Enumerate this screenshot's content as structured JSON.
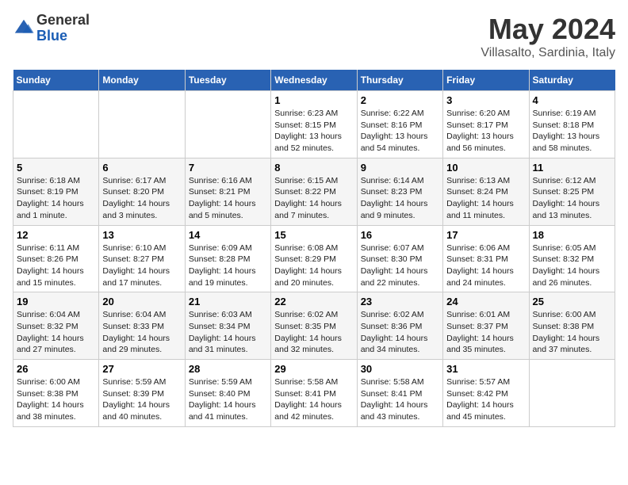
{
  "header": {
    "logo_line1": "General",
    "logo_line2": "Blue",
    "title": "May 2024",
    "location": "Villasalto, Sardinia, Italy"
  },
  "days_of_week": [
    "Sunday",
    "Monday",
    "Tuesday",
    "Wednesday",
    "Thursday",
    "Friday",
    "Saturday"
  ],
  "weeks": [
    [
      {
        "day": "",
        "sunrise": "",
        "sunset": "",
        "daylight": ""
      },
      {
        "day": "",
        "sunrise": "",
        "sunset": "",
        "daylight": ""
      },
      {
        "day": "",
        "sunrise": "",
        "sunset": "",
        "daylight": ""
      },
      {
        "day": "1",
        "sunrise": "Sunrise: 6:23 AM",
        "sunset": "Sunset: 8:15 PM",
        "daylight": "Daylight: 13 hours and 52 minutes."
      },
      {
        "day": "2",
        "sunrise": "Sunrise: 6:22 AM",
        "sunset": "Sunset: 8:16 PM",
        "daylight": "Daylight: 13 hours and 54 minutes."
      },
      {
        "day": "3",
        "sunrise": "Sunrise: 6:20 AM",
        "sunset": "Sunset: 8:17 PM",
        "daylight": "Daylight: 13 hours and 56 minutes."
      },
      {
        "day": "4",
        "sunrise": "Sunrise: 6:19 AM",
        "sunset": "Sunset: 8:18 PM",
        "daylight": "Daylight: 13 hours and 58 minutes."
      }
    ],
    [
      {
        "day": "5",
        "sunrise": "Sunrise: 6:18 AM",
        "sunset": "Sunset: 8:19 PM",
        "daylight": "Daylight: 14 hours and 1 minute."
      },
      {
        "day": "6",
        "sunrise": "Sunrise: 6:17 AM",
        "sunset": "Sunset: 8:20 PM",
        "daylight": "Daylight: 14 hours and 3 minutes."
      },
      {
        "day": "7",
        "sunrise": "Sunrise: 6:16 AM",
        "sunset": "Sunset: 8:21 PM",
        "daylight": "Daylight: 14 hours and 5 minutes."
      },
      {
        "day": "8",
        "sunrise": "Sunrise: 6:15 AM",
        "sunset": "Sunset: 8:22 PM",
        "daylight": "Daylight: 14 hours and 7 minutes."
      },
      {
        "day": "9",
        "sunrise": "Sunrise: 6:14 AM",
        "sunset": "Sunset: 8:23 PM",
        "daylight": "Daylight: 14 hours and 9 minutes."
      },
      {
        "day": "10",
        "sunrise": "Sunrise: 6:13 AM",
        "sunset": "Sunset: 8:24 PM",
        "daylight": "Daylight: 14 hours and 11 minutes."
      },
      {
        "day": "11",
        "sunrise": "Sunrise: 6:12 AM",
        "sunset": "Sunset: 8:25 PM",
        "daylight": "Daylight: 14 hours and 13 minutes."
      }
    ],
    [
      {
        "day": "12",
        "sunrise": "Sunrise: 6:11 AM",
        "sunset": "Sunset: 8:26 PM",
        "daylight": "Daylight: 14 hours and 15 minutes."
      },
      {
        "day": "13",
        "sunrise": "Sunrise: 6:10 AM",
        "sunset": "Sunset: 8:27 PM",
        "daylight": "Daylight: 14 hours and 17 minutes."
      },
      {
        "day": "14",
        "sunrise": "Sunrise: 6:09 AM",
        "sunset": "Sunset: 8:28 PM",
        "daylight": "Daylight: 14 hours and 19 minutes."
      },
      {
        "day": "15",
        "sunrise": "Sunrise: 6:08 AM",
        "sunset": "Sunset: 8:29 PM",
        "daylight": "Daylight: 14 hours and 20 minutes."
      },
      {
        "day": "16",
        "sunrise": "Sunrise: 6:07 AM",
        "sunset": "Sunset: 8:30 PM",
        "daylight": "Daylight: 14 hours and 22 minutes."
      },
      {
        "day": "17",
        "sunrise": "Sunrise: 6:06 AM",
        "sunset": "Sunset: 8:31 PM",
        "daylight": "Daylight: 14 hours and 24 minutes."
      },
      {
        "day": "18",
        "sunrise": "Sunrise: 6:05 AM",
        "sunset": "Sunset: 8:32 PM",
        "daylight": "Daylight: 14 hours and 26 minutes."
      }
    ],
    [
      {
        "day": "19",
        "sunrise": "Sunrise: 6:04 AM",
        "sunset": "Sunset: 8:32 PM",
        "daylight": "Daylight: 14 hours and 27 minutes."
      },
      {
        "day": "20",
        "sunrise": "Sunrise: 6:04 AM",
        "sunset": "Sunset: 8:33 PM",
        "daylight": "Daylight: 14 hours and 29 minutes."
      },
      {
        "day": "21",
        "sunrise": "Sunrise: 6:03 AM",
        "sunset": "Sunset: 8:34 PM",
        "daylight": "Daylight: 14 hours and 31 minutes."
      },
      {
        "day": "22",
        "sunrise": "Sunrise: 6:02 AM",
        "sunset": "Sunset: 8:35 PM",
        "daylight": "Daylight: 14 hours and 32 minutes."
      },
      {
        "day": "23",
        "sunrise": "Sunrise: 6:02 AM",
        "sunset": "Sunset: 8:36 PM",
        "daylight": "Daylight: 14 hours and 34 minutes."
      },
      {
        "day": "24",
        "sunrise": "Sunrise: 6:01 AM",
        "sunset": "Sunset: 8:37 PM",
        "daylight": "Daylight: 14 hours and 35 minutes."
      },
      {
        "day": "25",
        "sunrise": "Sunrise: 6:00 AM",
        "sunset": "Sunset: 8:38 PM",
        "daylight": "Daylight: 14 hours and 37 minutes."
      }
    ],
    [
      {
        "day": "26",
        "sunrise": "Sunrise: 6:00 AM",
        "sunset": "Sunset: 8:38 PM",
        "daylight": "Daylight: 14 hours and 38 minutes."
      },
      {
        "day": "27",
        "sunrise": "Sunrise: 5:59 AM",
        "sunset": "Sunset: 8:39 PM",
        "daylight": "Daylight: 14 hours and 40 minutes."
      },
      {
        "day": "28",
        "sunrise": "Sunrise: 5:59 AM",
        "sunset": "Sunset: 8:40 PM",
        "daylight": "Daylight: 14 hours and 41 minutes."
      },
      {
        "day": "29",
        "sunrise": "Sunrise: 5:58 AM",
        "sunset": "Sunset: 8:41 PM",
        "daylight": "Daylight: 14 hours and 42 minutes."
      },
      {
        "day": "30",
        "sunrise": "Sunrise: 5:58 AM",
        "sunset": "Sunset: 8:41 PM",
        "daylight": "Daylight: 14 hours and 43 minutes."
      },
      {
        "day": "31",
        "sunrise": "Sunrise: 5:57 AM",
        "sunset": "Sunset: 8:42 PM",
        "daylight": "Daylight: 14 hours and 45 minutes."
      },
      {
        "day": "",
        "sunrise": "",
        "sunset": "",
        "daylight": ""
      }
    ]
  ]
}
